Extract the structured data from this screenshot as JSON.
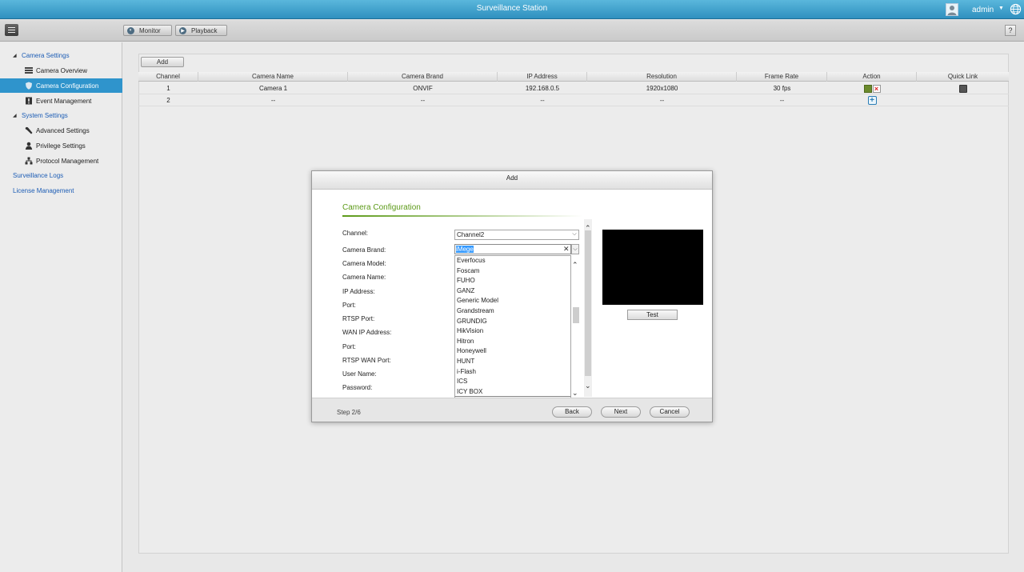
{
  "app": {
    "title": "Surveillance Station",
    "user": "admin"
  },
  "toolbar": {
    "monitor": "Monitor",
    "playback": "Playback",
    "help": "?"
  },
  "sidebar": {
    "camera_settings": "Camera Settings",
    "camera_overview": "Camera Overview",
    "camera_configuration": "Camera Configuration",
    "event_management": "Event Management",
    "system_settings": "System Settings",
    "advanced_settings": "Advanced Settings",
    "privilege_settings": "Privilege Settings",
    "protocol_management": "Protocol Management",
    "surveillance_logs": "Surveillance Logs",
    "license_management": "License Management"
  },
  "content": {
    "add_label": "Add",
    "columns": [
      "Channel",
      "Camera Name",
      "Camera Brand",
      "IP Address",
      "Resolution",
      "Frame Rate",
      "Action",
      "Quick Link"
    ],
    "rows": [
      {
        "channel": "1",
        "name": "Camera 1",
        "brand": "ONVIF",
        "ip": "192.168.0.5",
        "resolution": "1920x1080",
        "frame_rate": "30 fps"
      },
      {
        "channel": "2",
        "name": "--",
        "brand": "--",
        "ip": "--",
        "resolution": "--",
        "frame_rate": "--"
      }
    ]
  },
  "modal": {
    "title": "Add",
    "section": "Camera Configuration",
    "labels": {
      "channel": "Channel:",
      "camera_brand": "Camera Brand:",
      "camera_model": "Camera Model:",
      "camera_name": "Camera Name:",
      "ip_address": "IP Address:",
      "port": "Port:",
      "rtsp_port": "RTSP Port:",
      "wan_ip": "WAN IP Address:",
      "wan_port": "Port:",
      "rtsp_wan_port": "RTSP WAN Port:",
      "user_name": "User Name:",
      "password": "Password:"
    },
    "channel_value": "Channel2",
    "brand_value": "iMege",
    "brand_options": [
      "Everfocus",
      "Foscam",
      "FUHO",
      "GANZ",
      "Generic Model",
      "Grandstream",
      "GRUNDIG",
      "HikVision",
      "Hitron",
      "Honeywell",
      "HUNT",
      "i-Flash",
      "ICS",
      "ICY BOX"
    ],
    "brand_current": "iMege",
    "test_label": "Test",
    "step": "Step 2/6",
    "back_label": "Back",
    "next_label": "Next",
    "cancel_label": "Cancel"
  }
}
